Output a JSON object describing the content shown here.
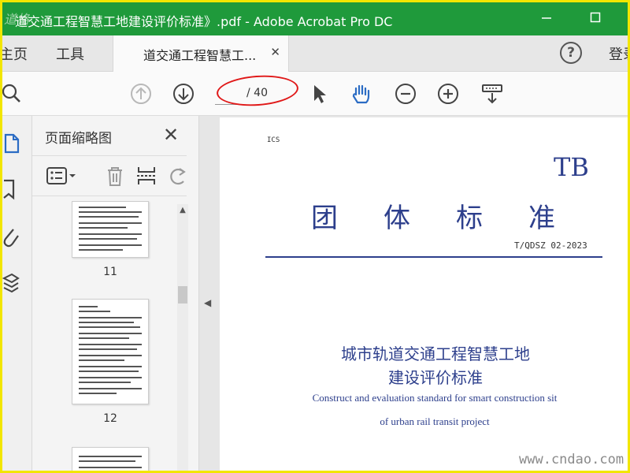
{
  "titlebar": {
    "title": "道交通工程智慧工地建设评价标准》.pdf - Adobe Acrobat Pro DC",
    "logo_text": "道格",
    "color": "#1f9a3b"
  },
  "tabs": {
    "home_label": "主页",
    "tools_label": "工具",
    "document_tab_label": "道交通工程智慧工...",
    "signin_label": "登录"
  },
  "toolbar": {
    "current_page": "",
    "total_pages": "/ 40"
  },
  "thumbnails": {
    "panel_title": "页面缩略图",
    "pages": [
      {
        "label": "11"
      },
      {
        "label": "12"
      }
    ]
  },
  "document": {
    "ics": "ICS",
    "code": "TB",
    "main_title": "团体标准",
    "standard_number": "T/QDSZ   02-2023",
    "title_cn_line1": "城市轨道交通工程智慧工地",
    "title_cn_line2": "建设评价标准",
    "title_en_line1": "Construct and evaluation standard for smart construction sit",
    "title_en_line2": "of urban rail transit project",
    "accent_color": "#2d3f8c"
  },
  "watermark": "www.cndao.com"
}
